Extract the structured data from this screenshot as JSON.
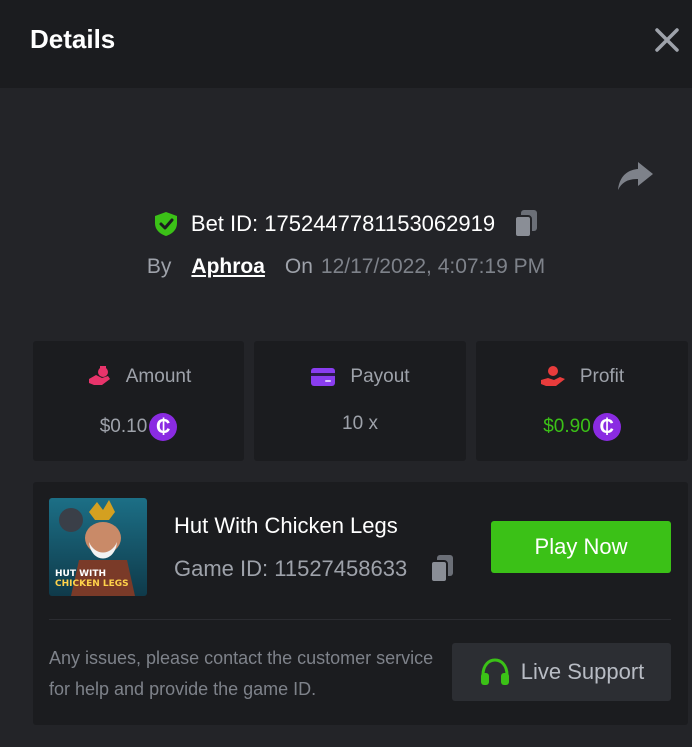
{
  "header": {
    "title": "Details"
  },
  "bet": {
    "id_label": "Bet ID: 1752447781153062919",
    "by_label": "By",
    "user": "Aphroa",
    "on_label": "On",
    "date": "12/17/2022, 4:07:19 PM"
  },
  "stats": [
    {
      "label": "Amount",
      "value": "$0.10",
      "icon": "money-bag-icon",
      "value_color": "#9ea2aa",
      "has_coin": true
    },
    {
      "label": "Payout",
      "value": "10 x",
      "icon": "wallet-card-icon",
      "value_color": "#9ea2aa",
      "has_coin": false
    },
    {
      "label": "Profit",
      "value": "$0.90",
      "icon": "hand-profit-icon",
      "value_color": "#3bc117",
      "has_coin": true
    }
  ],
  "coin_symbol": "₵",
  "game": {
    "name": "Hut With Chicken Legs",
    "id_label": "Game ID: 11527458633",
    "thumb_text": "HUT WITH CHICKEN LEGS",
    "play_label": "Play Now"
  },
  "support": {
    "message": "Any issues, please contact the customer service for help and provide the game ID.",
    "button_label": "Live Support"
  },
  "colors": {
    "accent_green": "#3bc117",
    "coin_purple": "#8a2be2",
    "amount_icon": "#e8346b",
    "payout_icon": "#8a3df0",
    "profit_icon": "#e83c3c"
  }
}
